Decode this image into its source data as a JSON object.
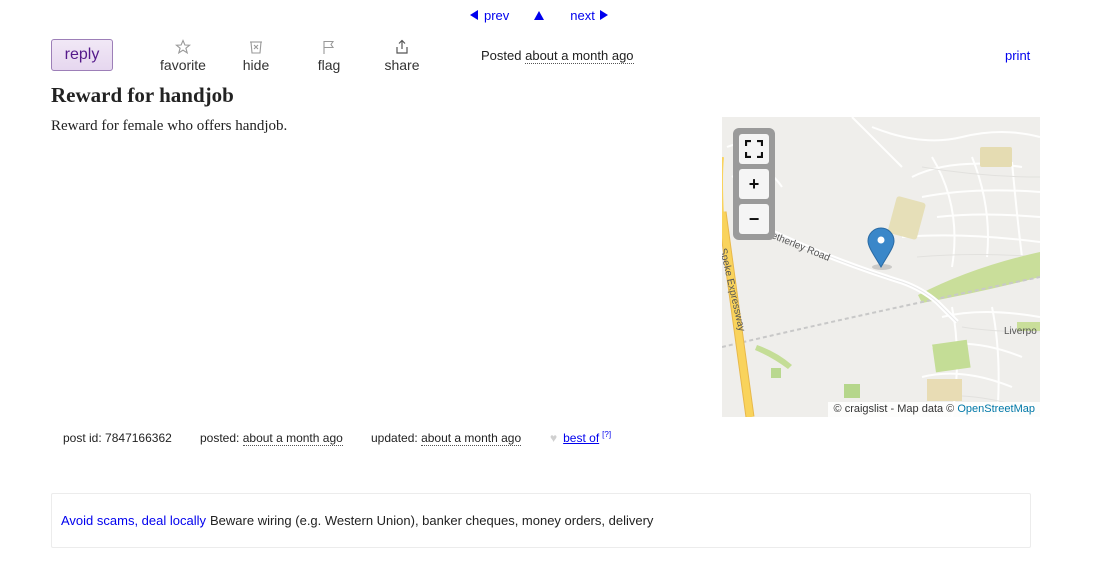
{
  "nav": {
    "prev": "prev",
    "next": "next"
  },
  "actions": {
    "reply": "reply",
    "favorite": "favorite",
    "hide": "hide",
    "flag": "flag",
    "share": "share"
  },
  "posting": {
    "posted_prefix": "Posted",
    "posted_time": "about a month ago",
    "print": "print",
    "title": "Reward for handjob",
    "body": "Reward for female who offers handjob."
  },
  "map": {
    "zoom_in": "+",
    "zoom_out": "−",
    "attribution_text": "© craigslist - Map data ©",
    "attribution_link": "OpenStreetMap",
    "road_label_1": "Netherley Road",
    "road_label_2": "Speke Expressway",
    "road_label_3": "Liverpo",
    "colors": {
      "motorway": "#f9d35c",
      "park": "#cbe09a",
      "marker": "#3a87c9"
    }
  },
  "meta": {
    "post_id_label": "post id:",
    "post_id": "7847166362",
    "posted_label": "posted:",
    "posted_time": "about a month ago",
    "updated_label": "updated:",
    "updated_time": "about a month ago",
    "best_of": "best of",
    "best_of_sup": "[?]"
  },
  "scam": {
    "link": "Avoid scams, deal locally",
    "text": "Beware wiring (e.g. Western Union), banker cheques, money orders, delivery"
  }
}
